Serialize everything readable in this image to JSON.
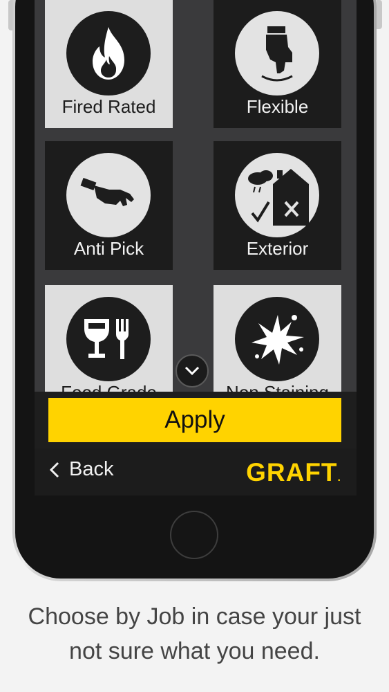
{
  "tiles": [
    {
      "label": "Fired Rated",
      "icon": "fire-icon",
      "selected": true
    },
    {
      "label": "Flexible",
      "icon": "hand-press-icon",
      "selected": false
    },
    {
      "label": "Anti Pick",
      "icon": "hand-icon",
      "selected": false
    },
    {
      "label": "Exterior",
      "icon": "house-weather-icon",
      "selected": false
    },
    {
      "label": "Food Grade",
      "icon": "cup-fork-icon",
      "selected": true
    },
    {
      "label": "Non Staining",
      "icon": "splash-icon",
      "selected": true
    }
  ],
  "apply_label": "Apply",
  "nav": {
    "back_label": "Back",
    "logo_text": "GRAFT",
    "logo_dot": "."
  },
  "caption": {
    "line1": "Choose by Job in case your just",
    "line2": "not sure what you need."
  },
  "colors": {
    "accent": "#ffd300",
    "tile_dark": "#1c1c1c",
    "tile_light": "#dedede"
  }
}
